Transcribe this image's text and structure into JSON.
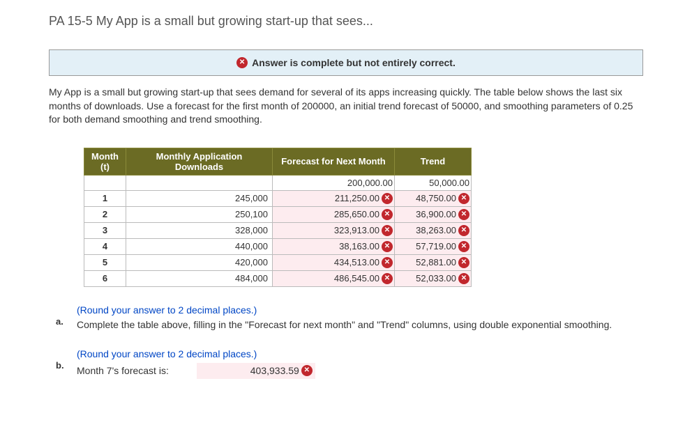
{
  "title": "PA 15-5 My App is a small but growing start-up that sees...",
  "banner": {
    "text": "Answer is complete but not entirely correct."
  },
  "intro": "My App is a small but growing start-up that sees demand for several of its apps increasing quickly. The table below shows the last six months of downloads. Use a forecast for the first month of 200000, an initial trend forecast of 50000, and smoothing parameters of 0.25 for both demand smoothing and trend smoothing.",
  "table": {
    "headers": {
      "month": "Month (t)",
      "downloads": "Monthly Application Downloads",
      "forecast": "Forecast for Next Month",
      "trend": "Trend"
    },
    "rows": [
      {
        "month": "",
        "downloads": "",
        "forecast": "200,000.00",
        "trend": "50,000.00",
        "fc_wrong": false,
        "tr_wrong": false
      },
      {
        "month": "1",
        "downloads": "245,000",
        "forecast": "211,250.00",
        "trend": "48,750.00",
        "fc_wrong": true,
        "tr_wrong": true
      },
      {
        "month": "2",
        "downloads": "250,100",
        "forecast": "285,650.00",
        "trend": "36,900.00",
        "fc_wrong": true,
        "tr_wrong": true
      },
      {
        "month": "3",
        "downloads": "328,000",
        "forecast": "323,913.00",
        "trend": "38,263.00",
        "fc_wrong": true,
        "tr_wrong": true
      },
      {
        "month": "4",
        "downloads": "440,000",
        "forecast": "38,163.00",
        "trend": "57,719.00",
        "fc_wrong": true,
        "tr_wrong": true
      },
      {
        "month": "5",
        "downloads": "420,000",
        "forecast": "434,513.00",
        "trend": "52,881.00",
        "fc_wrong": true,
        "tr_wrong": true
      },
      {
        "month": "6",
        "downloads": "484,000",
        "forecast": "486,545.00",
        "trend": "52,033.00",
        "fc_wrong": true,
        "tr_wrong": true
      }
    ]
  },
  "parts": {
    "a": {
      "hint": "(Round your answer to 2 decimal places.)",
      "text": "Complete the table above, filling in the \"Forecast for next month\" and \"Trend\" columns, using double exponential smoothing."
    },
    "b": {
      "hint": "(Round your answer to 2 decimal places.)",
      "prompt": "Month 7's forecast is:",
      "answer": "403,933.59",
      "wrong": true
    }
  }
}
